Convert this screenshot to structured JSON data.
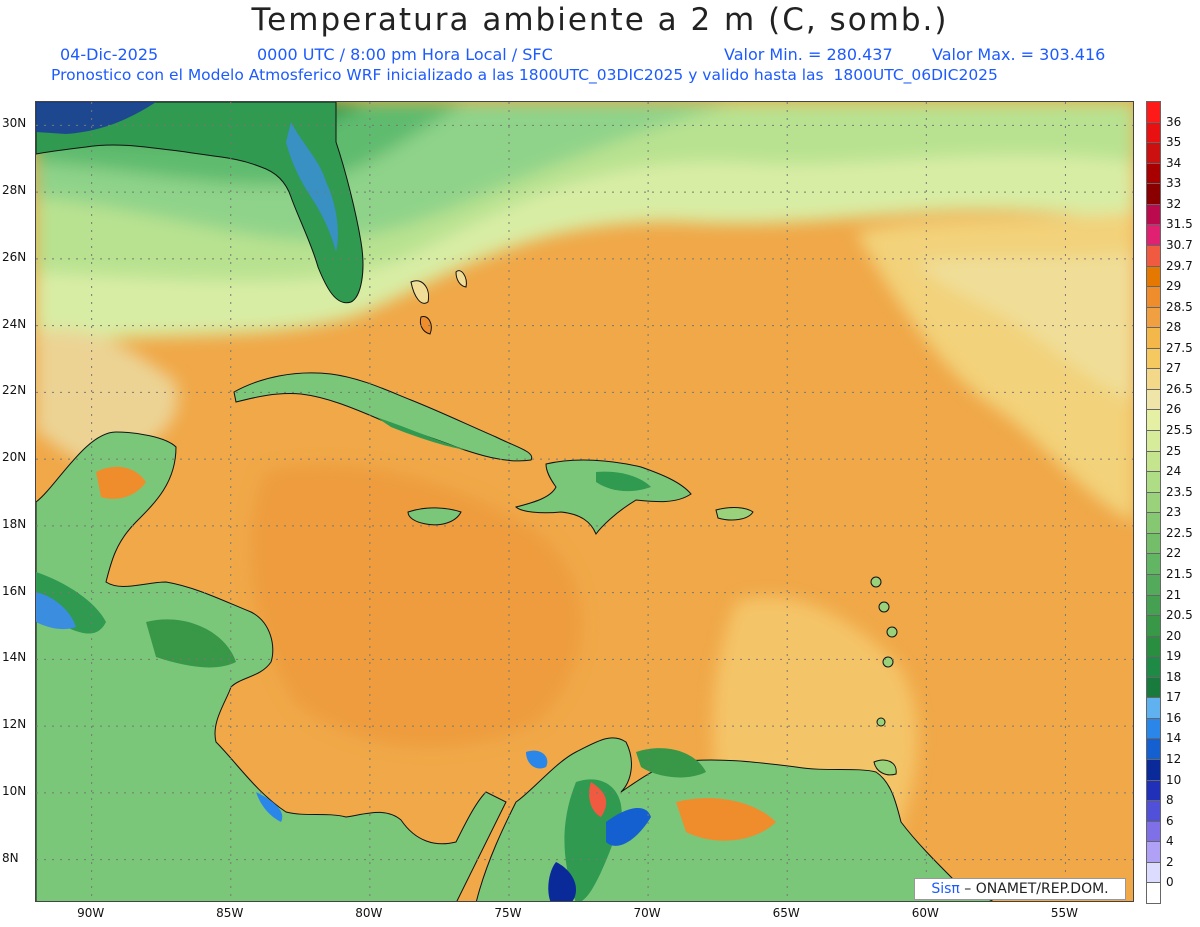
{
  "header": {
    "title": "Temperatura ambiente a 2 m (C, somb.)",
    "date": "04-Dic-2025",
    "time": "0000 UTC / 8:00 pm Hora Local / SFC",
    "min_label": "Valor Min. = 280.437",
    "max_label": "Valor Max. = 303.416",
    "model_info": "Pronostico con el Modelo Atmosferico WRF inicializado a las 1800UTC_03DIC2025 y valido hasta las  1800UTC_06DIC2025"
  },
  "map": {
    "lat_labels": [
      "30N",
      "28N",
      "26N",
      "24N",
      "22N",
      "20N",
      "18N",
      "16N",
      "14N",
      "12N",
      "10N",
      "8N"
    ],
    "lon_labels": [
      "90W",
      "85W",
      "80W",
      "75W",
      "70W",
      "65W",
      "60W",
      "55W"
    ],
    "extent": {
      "lon_min": -92,
      "lon_max": -52.5,
      "lat_min": 6.7,
      "lat_max": 30.7
    },
    "ocean_color": "#f0aa50",
    "land_color": "#7cc77a"
  },
  "colorbar": {
    "levels": [
      {
        "label": "36",
        "color": "#ff1a1a"
      },
      {
        "label": "35",
        "color": "#e81010"
      },
      {
        "label": "34",
        "color": "#cc0f0f"
      },
      {
        "label": "33",
        "color": "#a80000"
      },
      {
        "label": "32",
        "color": "#8a0000"
      },
      {
        "label": "31.5",
        "color": "#bb0a4e"
      },
      {
        "label": "30.7",
        "color": "#e02070"
      },
      {
        "label": "29.7",
        "color": "#f05a40"
      },
      {
        "label": "29",
        "color": "#e47800"
      },
      {
        "label": "28.5",
        "color": "#ef8d2d"
      },
      {
        "label": "28",
        "color": "#f0a040"
      },
      {
        "label": "27.5",
        "color": "#f4b84a"
      },
      {
        "label": "27",
        "color": "#f6c860"
      },
      {
        "label": "26.5",
        "color": "#f2d888"
      },
      {
        "label": "26",
        "color": "#f0e5a8"
      },
      {
        "label": "25.5",
        "color": "#e6f0a5"
      },
      {
        "label": "25",
        "color": "#d6ec9a"
      },
      {
        "label": "24",
        "color": "#c4e48e"
      },
      {
        "label": "23.5",
        "color": "#aedd85"
      },
      {
        "label": "23",
        "color": "#9ad27c"
      },
      {
        "label": "22.5",
        "color": "#86c872"
      },
      {
        "label": "22",
        "color": "#74be6a"
      },
      {
        "label": "21.5",
        "color": "#62b562"
      },
      {
        "label": "21",
        "color": "#52aa5a"
      },
      {
        "label": "20.5",
        "color": "#45a052"
      },
      {
        "label": "20",
        "color": "#389848"
      },
      {
        "label": "19",
        "color": "#2a8e40"
      },
      {
        "label": "18",
        "color": "#1f8a45"
      },
      {
        "label": "17",
        "color": "#187a3c"
      },
      {
        "label": "16",
        "color": "#5fb1f0"
      },
      {
        "label": "14",
        "color": "#2a86e8"
      },
      {
        "label": "12",
        "color": "#1560d0"
      },
      {
        "label": "10",
        "color": "#0a2a9a"
      },
      {
        "label": "8",
        "color": "#2030b8"
      },
      {
        "label": "6",
        "color": "#5050d8"
      },
      {
        "label": "4",
        "color": "#8070e8"
      },
      {
        "label": "2",
        "color": "#b0a0f6"
      },
      {
        "label": "0",
        "color": "#dcdcff"
      },
      {
        "label": "",
        "color": "#ffffff"
      }
    ]
  },
  "credit": {
    "sis": "Sisπ",
    "org": " – ONAMET/REP.DOM."
  }
}
